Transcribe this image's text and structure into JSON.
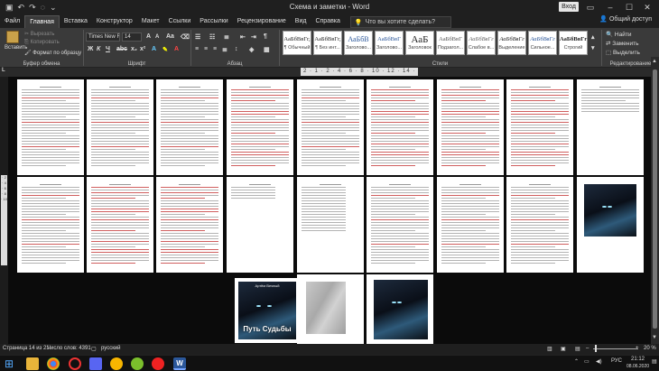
{
  "window": {
    "title": "Схема и заметки  -  Word",
    "signin": "Вход"
  },
  "menu": {
    "tabs": [
      "Файл",
      "Главная",
      "Вставка",
      "Конструктор",
      "Макет",
      "Ссылки",
      "Рассылки",
      "Рецензирование",
      "Вид",
      "Справка"
    ],
    "tell_me": "Что вы хотите сделать?",
    "share": "Общий доступ"
  },
  "ribbon": {
    "clipboard": {
      "paste": "Вставить",
      "cut": "Вырезать",
      "copy": "Копировать",
      "format": "Формат по образцу",
      "label": "Буфер обмена"
    },
    "font": {
      "name": "Times New R",
      "size": "14",
      "label": "Шрифт",
      "grow": "A",
      "shrink": "A",
      "bold": "Ж",
      "italic": "К",
      "underline": "Ч"
    },
    "paragraph": {
      "label": "Абзац"
    },
    "styles": {
      "label": "Стили",
      "items": [
        {
          "preview": "АаБбВвГг,",
          "name": "¶ Обычный"
        },
        {
          "preview": "АаБбВвГг,",
          "name": "¶ Без инт..."
        },
        {
          "preview": "АаБбВ",
          "name": "Заголово..."
        },
        {
          "preview": "АаБбВвГ",
          "name": "Заголово..."
        },
        {
          "preview": "АаБ",
          "name": "Заголовок"
        },
        {
          "preview": "АаБбВвГ",
          "name": "Подзагол..."
        },
        {
          "preview": "АаБбВвГг",
          "name": "Слабое в..."
        },
        {
          "preview": "АаБбВвГг",
          "name": "Выделение"
        },
        {
          "preview": "АаБбВвГг",
          "name": "Сильное..."
        },
        {
          "preview": "АаБбВвГг",
          "name": "Строгий"
        }
      ]
    },
    "editing": {
      "find": "Найти",
      "replace": "Заменить",
      "select": "Выделить",
      "label": "Редактирование"
    }
  },
  "ruler": {
    "ticks": "2 · 1 · 2 · 4 · 6 · 8 · 10 · 12 · 14 ·"
  },
  "covers": {
    "title": "Путь Судьбы",
    "author": "Артём Вечный"
  },
  "status": {
    "page": "Страница 14 из 21",
    "words": "Число слов: 4391",
    "lang": "русский",
    "zoom": "20 %"
  },
  "taskbar": {
    "time": "21:12",
    "date": "08.06.2020",
    "lang": "РУС"
  },
  "colors": {
    "accent": "#2b579a",
    "ribbon": "#3a3a3a",
    "titlebar": "#1f1f1f",
    "canvas": "#0b0b0b"
  }
}
